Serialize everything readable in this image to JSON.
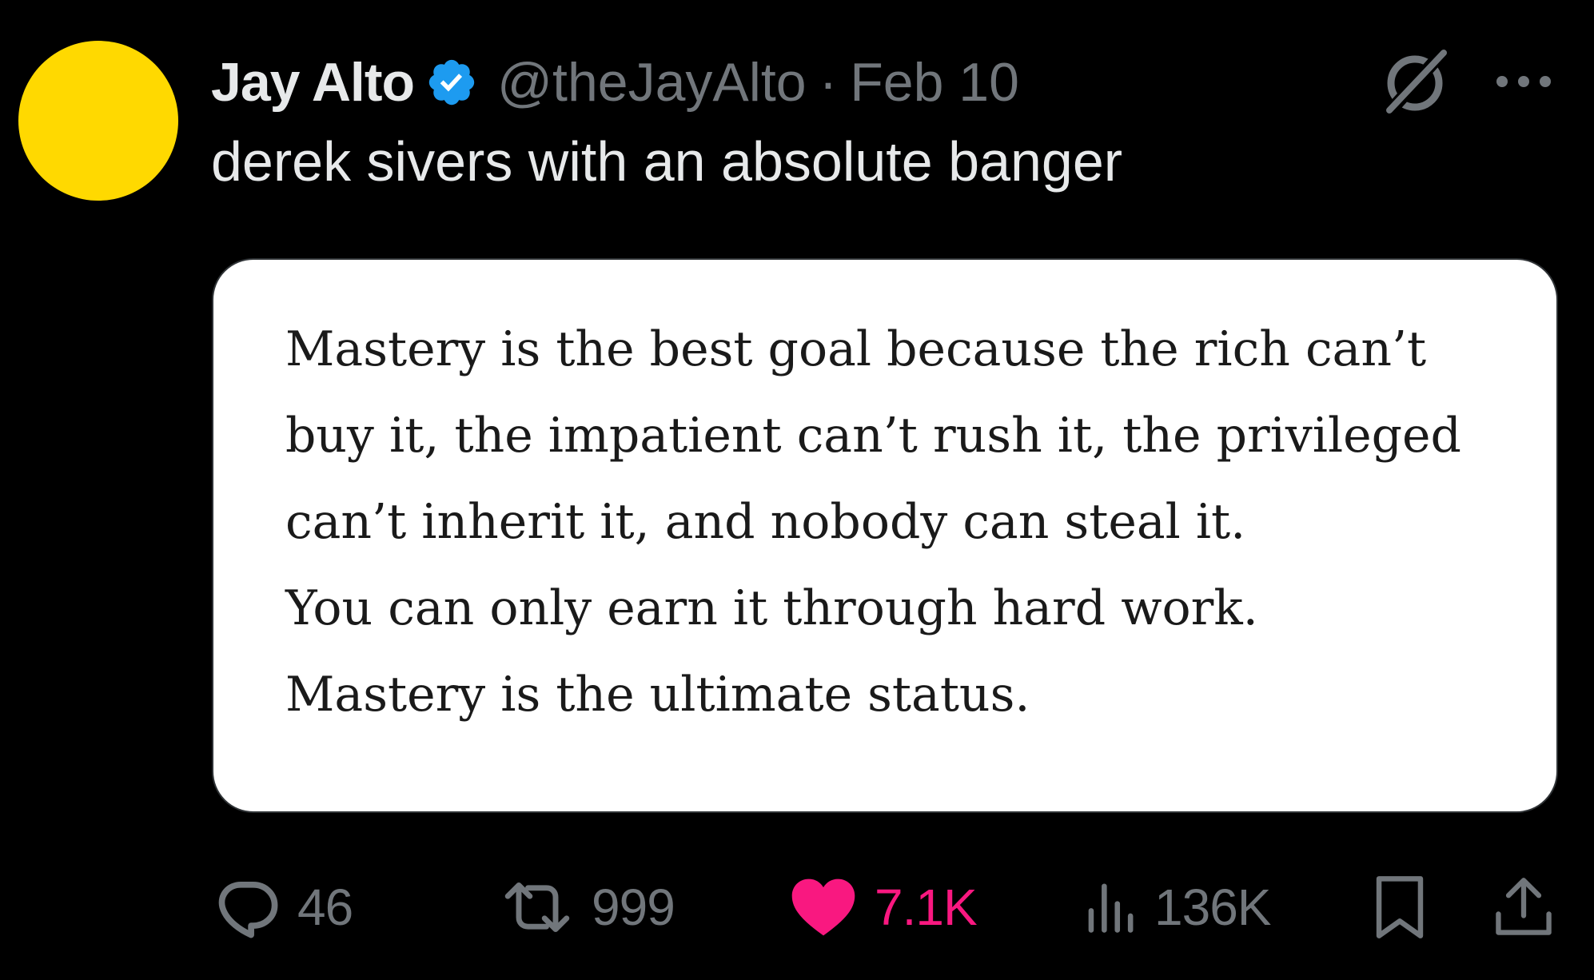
{
  "author": {
    "display_name": "Jay Alto",
    "handle": "@theJayAlto",
    "separator": "·",
    "date": "Feb 10",
    "avatar_color": "#FFD900",
    "verified_badge_color": "#1D9BF0"
  },
  "tweet": {
    "text": "derek sivers with an absolute banger"
  },
  "media": {
    "quote_lines": [
      "Mastery is the best goal because the rich can’t",
      "buy it, the impatient can’t rush it, the privileged",
      "can’t inherit it, and nobody can steal it.",
      "You can only earn it through hard work.",
      "Mastery is the ultimate status."
    ]
  },
  "actions": {
    "replies": "46",
    "reposts": "999",
    "likes": "7.1K",
    "views": "136K",
    "like_color": "#F91880",
    "muted_color": "#71767B"
  },
  "icons": {
    "top_right": [
      "grok-icon",
      "more-icon"
    ],
    "bottom": [
      "reply-icon",
      "repost-icon",
      "like-icon",
      "views-icon",
      "bookmark-icon",
      "share-icon"
    ]
  }
}
